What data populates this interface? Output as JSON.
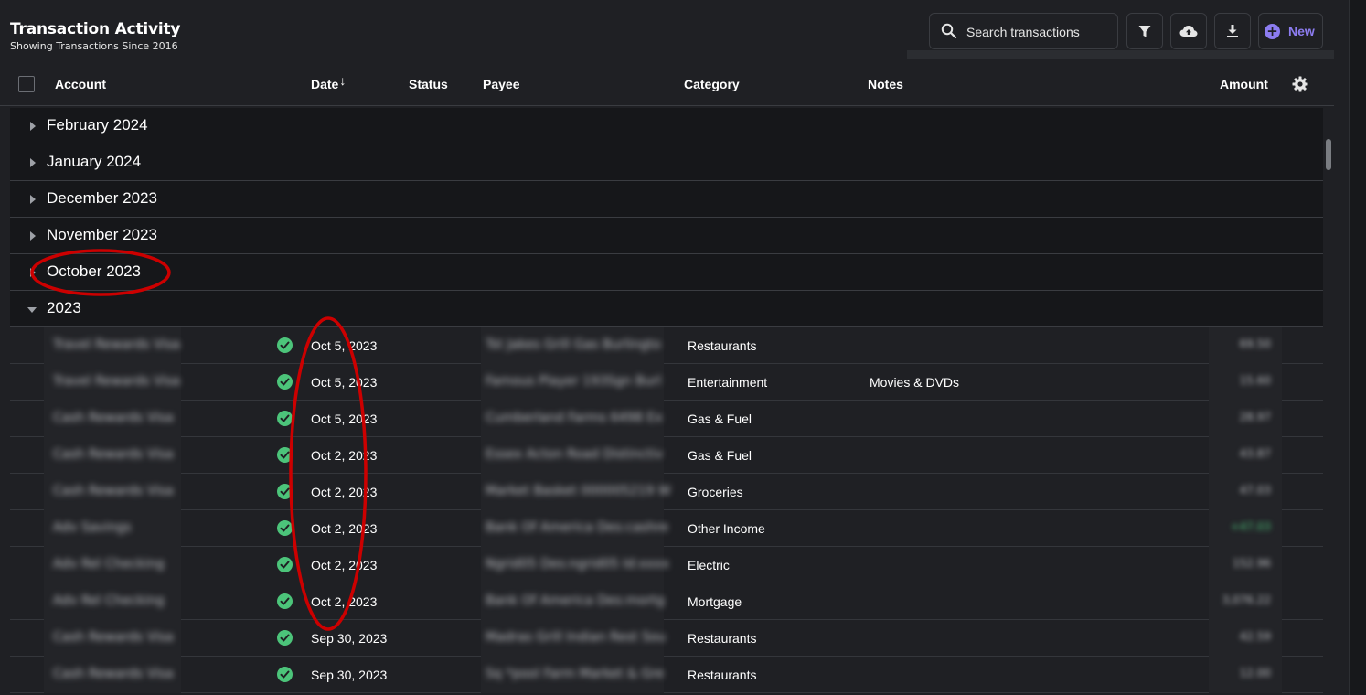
{
  "header": {
    "title": "Transaction Activity",
    "subtitle": "Showing Transactions Since 2016"
  },
  "toolbar": {
    "search_placeholder": "Search transactions",
    "new_label": "New",
    "icons": [
      "search-icon",
      "filter-icon",
      "cloud-upload-icon",
      "download-icon",
      "plus-circle-icon"
    ]
  },
  "columns": {
    "account": "Account",
    "date": "Date",
    "date_sort": "↓",
    "status": "Status",
    "payee": "Payee",
    "category": "Category",
    "notes": "Notes",
    "amount": "Amount"
  },
  "groups": [
    {
      "label": "February 2024",
      "expanded": false
    },
    {
      "label": "January 2024",
      "expanded": false
    },
    {
      "label": "December 2023",
      "expanded": false
    },
    {
      "label": "November 2023",
      "expanded": false
    },
    {
      "label": "October 2023",
      "expanded": false
    },
    {
      "label": "2023",
      "expanded": true
    }
  ],
  "transactions": [
    {
      "account": "Travel Rewards Visa",
      "date": "Oct 5, 2023",
      "payee": "Tst Jakes Grill Gas Burlingto",
      "category": "Restaurants",
      "notes": "",
      "amount": "69.50"
    },
    {
      "account": "Travel Rewards Visa",
      "date": "Oct 5, 2023",
      "payee": "Famous Player 193Sgn Burl",
      "category": "Entertainment",
      "notes": "Movies & DVDs",
      "amount": "15.60"
    },
    {
      "account": "Cash Rewards Visa",
      "date": "Oct 5, 2023",
      "payee": "Cumberland Farms 6498 Ex",
      "category": "Gas & Fuel",
      "notes": "",
      "amount": "28.97"
    },
    {
      "account": "Cash Rewards Visa",
      "date": "Oct 2, 2023",
      "payee": "Essex Acton Road Distinctiv",
      "category": "Gas & Fuel",
      "notes": "",
      "amount": "43.87"
    },
    {
      "account": "Cash Rewards Visa",
      "date": "Oct 2, 2023",
      "payee": "Market Basket 000005219 W",
      "category": "Groceries",
      "notes": "",
      "amount": "47.03"
    },
    {
      "account": "Adv Savings",
      "date": "Oct 2, 2023",
      "payee": "Bank Of America Des:cashre",
      "category": "Other Income",
      "notes": "",
      "amount": "+47.03"
    },
    {
      "account": "Adv Rel Checking",
      "date": "Oct 2, 2023",
      "payee": "Ngrid05 Des:ngrid05 Id:xxxx",
      "category": "Electric",
      "notes": "",
      "amount": "152.96"
    },
    {
      "account": "Adv Rel Checking",
      "date": "Oct 2, 2023",
      "payee": "Bank Of America Des:mortg",
      "category": "Mortgage",
      "notes": "",
      "amount": "3,076.22"
    },
    {
      "account": "Cash Rewards Visa",
      "date": "Sep 30, 2023",
      "payee": "Madras Grill Indian Rest Sou",
      "category": "Restaurants",
      "notes": "",
      "amount": "42.59"
    },
    {
      "account": "Cash Rewards Visa",
      "date": "Sep 30, 2023",
      "payee": "Sq *pool Farm Market & Gre",
      "category": "Restaurants",
      "notes": "",
      "amount": "12.00"
    }
  ],
  "colors": {
    "background": "#1f2024",
    "group_background": "#16171a",
    "accent": "#8c7cf0",
    "status_cleared": "#4cc47a",
    "annotation": "#cc0000"
  }
}
